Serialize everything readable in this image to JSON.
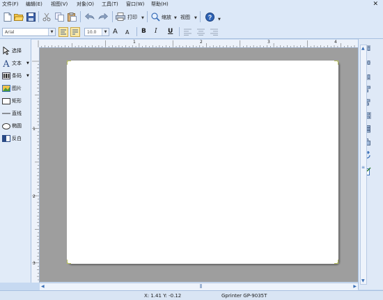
{
  "menu": {
    "file": "文件(F)",
    "edit": "编辑(E)",
    "view": "视图(V)",
    "object": "对象(O)",
    "tools": "工具(T)",
    "window": "窗口(W)",
    "help": "帮助(H)"
  },
  "window": {
    "close_glyph": "✕"
  },
  "toolbar": {
    "print_label": "打印",
    "zoom_label": "缩放",
    "view_label": "视图",
    "font_value": "Arial",
    "size_value": "10.0",
    "bold_label": "B",
    "italic_label": "I",
    "underline_label": "U",
    "grow_font_label": "A",
    "shrink_font_label": "A"
  },
  "tools": {
    "select": "选择",
    "text": "文本",
    "barcode": "条码",
    "image": "图片",
    "rect": "矩形",
    "line": "直线",
    "ellipse": "椭圆",
    "inverse": "反白"
  },
  "ruler": {
    "h_ticks": [
      "1",
      "2",
      "3",
      "4"
    ],
    "v_ticks": [
      "1",
      "2",
      "3"
    ]
  },
  "status": {
    "coords": "X: 1.41 Y: -0.12",
    "printer": "Gprinter GP-9035T"
  },
  "colors": {
    "accent": "#3a6fb7",
    "canvas_bg": "#9e9e9e",
    "corner_marker": "#b9c05a"
  },
  "icons": {
    "new": "new-document-icon",
    "open": "open-folder-icon",
    "save": "save-icon",
    "cut": "cut-icon",
    "copy": "copy-icon",
    "paste": "paste-icon",
    "undo": "undo-icon",
    "redo": "redo-icon",
    "print": "printer-icon",
    "zoom": "magnifier-icon",
    "help": "help-icon"
  }
}
